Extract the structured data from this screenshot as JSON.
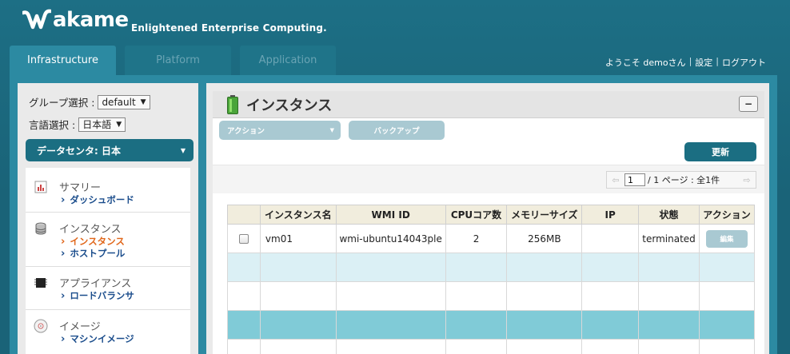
{
  "brand": {
    "name": "akame",
    "tagline": "Enlightened Enterprise Computing."
  },
  "tabs": [
    {
      "label": "Infrastructure",
      "active": true
    },
    {
      "label": "Platform",
      "active": false
    },
    {
      "label": "Application",
      "active": false
    }
  ],
  "user_links": {
    "welcome": "ようこそ demoさん",
    "separator": "|",
    "settings": "設定",
    "logout": "ログアウト"
  },
  "left": {
    "group_label": "グループ選択 :",
    "group_value": "default",
    "language_label": "言語選択 :",
    "language_value": "日本語",
    "datacenter": "データセンタ: 日本",
    "menu": [
      {
        "title": "サマリー",
        "icon": "chart-icon",
        "links": [
          {
            "label": "ダッシュボード",
            "active": false
          }
        ]
      },
      {
        "title": "インスタンス",
        "icon": "database-icon",
        "links": [
          {
            "label": "インスタンス",
            "active": true
          },
          {
            "label": "ホストプール",
            "active": false
          }
        ]
      },
      {
        "title": "アプライアンス",
        "icon": "chip-icon",
        "links": [
          {
            "label": "ロードバランサ",
            "active": false
          }
        ]
      },
      {
        "title": "イメージ",
        "icon": "disc-icon",
        "links": [
          {
            "label": "マシンイメージ",
            "active": false
          }
        ]
      }
    ]
  },
  "panel": {
    "title": "インスタンス",
    "collapse_symbol": "−",
    "toolbar": {
      "action_label": "アクション",
      "backup_label": "バックアップ",
      "refresh_label": "更新"
    },
    "pager": {
      "prev": "⇦",
      "next": "⇨",
      "page_value": "1",
      "info": "/ 1 ページ : 全1件"
    }
  },
  "table": {
    "headers": [
      "",
      "インスタンス名",
      "WMI ID",
      "CPUコア数",
      "メモリーサイズ",
      "IP",
      "状態",
      "アクション"
    ],
    "rows": [
      {
        "name": "vm01",
        "wmi_id": "wmi-ubuntu14043ple",
        "cpu": "2",
        "memory": "256MB",
        "ip": "",
        "state": "terminated",
        "action": "編集"
      }
    ]
  },
  "colors": {
    "accent": "#1b6e82",
    "header_bg": "#1d6f85",
    "frame": "#2c8aa2",
    "row_light": "#dbf0f5",
    "row_dark": "#80cbd7"
  }
}
